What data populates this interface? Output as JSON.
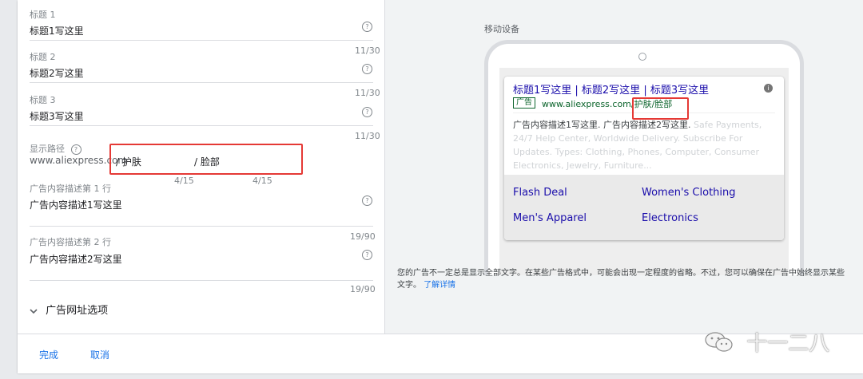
{
  "form": {
    "fields": [
      {
        "label": "标题 1",
        "value": "标题1写这里",
        "counter": "11/30"
      },
      {
        "label": "标题 2",
        "value": "标题2写这里",
        "counter": "11/30"
      },
      {
        "label": "标题 3",
        "value": "标题3写这里",
        "counter": "11/30"
      }
    ],
    "display_path": {
      "label": "显示路径",
      "base_url": "www.aliexpress.com",
      "path1": "/ 护肤",
      "path2": "/ 脸部",
      "path1_counter": "4/15",
      "path2_counter": "4/15"
    },
    "descriptions": [
      {
        "label": "广告内容描述第 1 行",
        "value": "广告内容描述1写这里",
        "counter": "19/90"
      },
      {
        "label": "广告内容描述第 2 行",
        "value": "广告内容描述2写这里",
        "counter": "19/90"
      }
    ],
    "url_options_label": "广告网址选项",
    "help_glyph": "?"
  },
  "preview": {
    "title": "移动设备",
    "ad": {
      "headline": "标题1写这里 | 标题2写这里 | 标题3写这里",
      "badge": "广告",
      "url": "www.aliexpress.com/护肤/脸部",
      "info_glyph": "i",
      "description": "广告内容描述1写这里. 广告内容描述2写这里.",
      "description_extra": "Safe Payments, 24/7 Help Center, Worldwide Delivery. Subscribe For Updates. Types: Clothing, Phones, Computer, Consumer Electronics, Jewelry, Furniture...",
      "sitelinks": [
        "Flash Deal",
        "Women's Clothing",
        "Men's Apparel",
        "Electronics"
      ]
    },
    "note": "您的广告不一定总是显示全部文字。在某些广告格式中，可能会出现一定程度的省略。不过，您可以确保在广告中始终显示某些文字。",
    "learn_more": "了解详情"
  },
  "footer": {
    "done_label": "完成",
    "cancel_label": "取消"
  },
  "watermark": "十一二八",
  "colors": {
    "link_blue": "#1a0dab",
    "accent_blue": "#1a73e8",
    "url_green": "#0d652d",
    "highlight_red": "#e53935"
  }
}
